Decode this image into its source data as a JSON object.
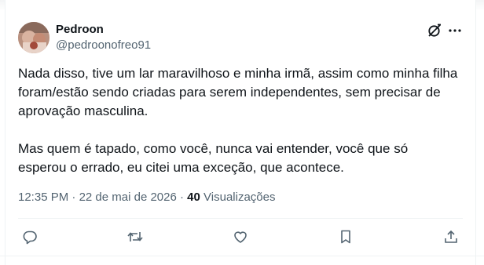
{
  "tweet": {
    "author_name": "Pedroon",
    "author_handle": "@pedroonofreo91",
    "paragraphs": [
      "Nada disso, tive um lar maravilhoso e minha irmã, assim como minha filha foram/estão sendo criadas para serem independentes, sem precisar de aprovação masculina.",
      "Mas quem é tapado, como você, nunca vai entender, você que só esperou o errado, eu citei uma exceção, que acontece."
    ],
    "time": "12:35 PM",
    "date": "22 de mai de 2026",
    "views_count": "40",
    "views_label": "Visualizações"
  },
  "icons": {
    "grok": "grok-icon",
    "more": "more-icon",
    "reply": "reply-icon",
    "repost": "repost-icon",
    "like": "like-icon",
    "bookmark": "bookmark-icon",
    "share": "share-icon"
  },
  "colors": {
    "text": "#0f1419",
    "secondary": "#536471",
    "border": "#eff3f4"
  }
}
